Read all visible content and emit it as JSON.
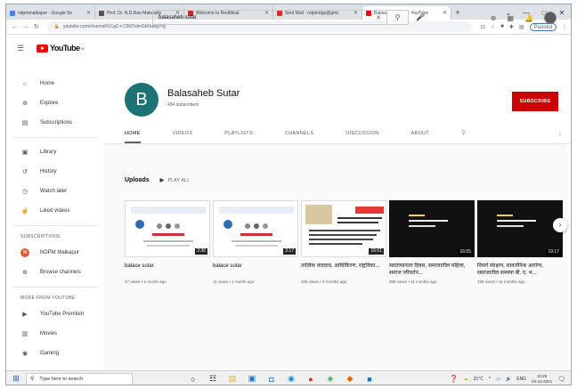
{
  "browser": {
    "tabs": [
      {
        "title": "ndpmmalkapur - Google Se",
        "color": "#4285f4",
        "active": false
      },
      {
        "title": "Prof. Dr. N.D.Rao Malwadiy",
        "color": "#555555",
        "active": false
      },
      {
        "title": "Welcome to RedMixal",
        "color": "#c62828",
        "active": false
      },
      {
        "title": "Sent Mail - ndpmripp@gmc",
        "color": "#d93025",
        "active": false
      },
      {
        "title": "Balasaheb Sutar - YouTube",
        "color": "#ff0000",
        "active": true
      }
    ],
    "new_tab": "+",
    "window_controls": [
      "⌄",
      "—",
      "□",
      "✕"
    ],
    "url": "youtube.com/channel/UCgC-t-C8tZ5dmGbDdBgYrg",
    "paused_label": "Paused"
  },
  "youtube": {
    "logo_text": "YouTube",
    "logo_region": "IN",
    "search_value": "balasaheb sutar"
  },
  "sidebar": {
    "main": [
      {
        "icon": "⌂",
        "label": "Home"
      },
      {
        "icon": "⊕",
        "label": "Explore"
      },
      {
        "icon": "▤",
        "label": "Subscriptions"
      }
    ],
    "library": [
      {
        "icon": "▣",
        "label": "Library"
      },
      {
        "icon": "↺",
        "label": "History"
      },
      {
        "icon": "◷",
        "label": "Watch later"
      },
      {
        "icon": "☝",
        "label": "Liked videos"
      }
    ],
    "subscriptions_heading": "SUBSCRIPTIONS",
    "subscriptions": [
      {
        "initial": "N",
        "label": "NDPM Malkapur"
      },
      {
        "icon": "⊕",
        "label": "Browse channels"
      }
    ],
    "more_heading": "MORE FROM YOUTUBE",
    "more": [
      {
        "icon": "▶",
        "label": "YouTube Premium"
      },
      {
        "icon": "▥",
        "label": "Movies"
      },
      {
        "icon": "◉",
        "label": "Gaming"
      }
    ]
  },
  "channel": {
    "initial": "B",
    "name": "Balasaheb Sutar",
    "subscribers": "494 subscribers",
    "subscribe_label": "SUBSCRIBE",
    "tabs": [
      "HOME",
      "VIDEOS",
      "PLAYLISTS",
      "CHANNELS",
      "DISCUSSION",
      "ABOUT"
    ],
    "active_tab": "HOME"
  },
  "uploads": {
    "title": "Uploads",
    "play_all": "PLAY ALL",
    "videos": [
      {
        "title": "balace sutar",
        "meta": "27 views • 1 month ago",
        "duration": "2:36",
        "style": "light"
      },
      {
        "title": "balace sutar",
        "meta": "11 views • 1 month ago",
        "duration": "2:17",
        "style": "light"
      },
      {
        "title": "तात्विक वादवाद, आधिकिरण, राष्ट्रविका...",
        "meta": "106 views • 3 months ago",
        "duration": "16:01",
        "style": "doc"
      },
      {
        "title": "स्वातंत्र्यानंतर दिवस, समाजातील महिला, समाज परिवर्तन...",
        "meta": "308 views • 11 months ago",
        "duration": "16:55",
        "style": "dark"
      },
      {
        "title": "निसर्ग संरक्षण, सावर्जनिक आरोग्य, समाजातील समस्या बी. ए. भ...",
        "meta": "228 views • 11 months ago",
        "duration": "19:17",
        "style": "dark"
      }
    ]
  },
  "taskbar": {
    "search_placeholder": "Type here to search",
    "apps": [
      "○",
      "☷",
      "▤",
      "▣",
      "◘",
      "◉",
      "●",
      "◈",
      "◆",
      "■"
    ],
    "weather": "31°C",
    "language": "ENG",
    "time": "15:26",
    "date": "04-10-2021"
  }
}
